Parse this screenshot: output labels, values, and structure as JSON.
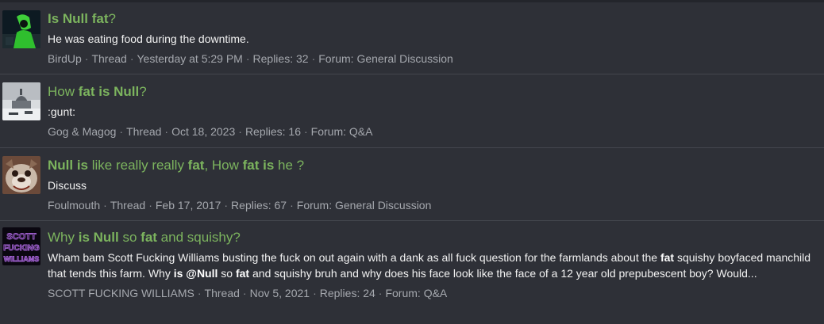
{
  "results": [
    {
      "title_parts": [
        {
          "text": "Is Null ",
          "bold": true
        },
        {
          "text": "fat",
          "bold": true
        },
        {
          "text": "?",
          "bold": false
        }
      ],
      "snippet_parts": [
        {
          "text": "He was eating food during the downtime.",
          "bold": false
        }
      ],
      "author": "BirdUp",
      "type": "Thread",
      "date": "Yesterday at 5:29 PM",
      "replies": "Replies: 32",
      "forum": "Forum: General Discussion",
      "avatar": "green-figure-avatar"
    },
    {
      "title_parts": [
        {
          "text": "How ",
          "bold": false
        },
        {
          "text": "fat is Null",
          "bold": true
        },
        {
          "text": "?",
          "bold": false
        }
      ],
      "snippet_parts": [
        {
          "text": ":gunt:",
          "bold": false
        }
      ],
      "author": "Gog & Magog",
      "type": "Thread",
      "date": "Oct 18, 2023",
      "replies": "Replies: 16",
      "forum": "Forum: Q&A",
      "avatar": "snowy-mosque-avatar"
    },
    {
      "title_parts": [
        {
          "text": "Null is",
          "bold": true
        },
        {
          "text": " like really really ",
          "bold": false
        },
        {
          "text": "fat",
          "bold": true
        },
        {
          "text": ", How ",
          "bold": false
        },
        {
          "text": "fat is",
          "bold": true
        },
        {
          "text": " he ?",
          "bold": false
        }
      ],
      "snippet_parts": [
        {
          "text": "Discuss",
          "bold": false
        }
      ],
      "author": "Foulmouth",
      "type": "Thread",
      "date": "Feb 17, 2017",
      "replies": "Replies: 67",
      "forum": "Forum: General Discussion",
      "avatar": "bulldog-avatar"
    },
    {
      "title_parts": [
        {
          "text": "Why ",
          "bold": false
        },
        {
          "text": "is Null",
          "bold": true
        },
        {
          "text": " so ",
          "bold": false
        },
        {
          "text": "fat",
          "bold": true
        },
        {
          "text": " and squishy?",
          "bold": false
        }
      ],
      "snippet_parts": [
        {
          "text": "Wham bam Scott Fucking Williams busting the fuck on out again with a dank as all fuck question for the farmlands about the ",
          "bold": false
        },
        {
          "text": "fat",
          "bold": true
        },
        {
          "text": " squishy boyfaced manchild that tends this farm. Why ",
          "bold": false
        },
        {
          "text": "is @Null",
          "bold": true
        },
        {
          "text": " so ",
          "bold": false
        },
        {
          "text": "fat",
          "bold": true
        },
        {
          "text": " and squishy bruh and why does his face look like the face of a 12 year old prepubescent boy? Would...",
          "bold": false
        }
      ],
      "author": "SCOTT FUCKING WILLIAMS",
      "type": "Thread",
      "date": "Nov 5, 2021",
      "replies": "Replies: 24",
      "forum": "Forum: Q&A",
      "avatar": "purple-text-logo-avatar",
      "avatar_text": [
        "SCOTT",
        "FUCKING",
        "WILLIAMS"
      ]
    }
  ],
  "colors": {
    "background": "#2e3037",
    "link_green": "#7cb45e",
    "meta_gray": "#a5a8ae",
    "divider": "#43464e"
  }
}
